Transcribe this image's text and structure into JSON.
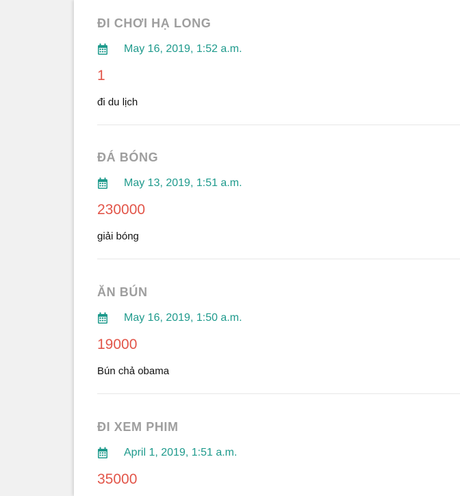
{
  "entries": [
    {
      "title": "ĐI CHƠI HẠ LONG",
      "date": "May 16, 2019, 1:52 a.m.",
      "amount": "1",
      "description": "đi du lịch"
    },
    {
      "title": "ĐÁ BÓNG",
      "date": "May 13, 2019, 1:51 a.m.",
      "amount": "230000",
      "description": "giải bóng"
    },
    {
      "title": "ĂN BÚN",
      "date": "May 16, 2019, 1:50 a.m.",
      "amount": "19000",
      "description": "Bún chả obama"
    },
    {
      "title": "ĐI XEM PHIM",
      "date": "April 1, 2019, 1:51 a.m.",
      "amount": "35000",
      "description": ""
    }
  ],
  "icons": {
    "date": "calendar-icon"
  },
  "colors": {
    "title": "#9e9e9e",
    "date": "#1e9a8c",
    "amount": "#e25549",
    "description": "#111111"
  }
}
